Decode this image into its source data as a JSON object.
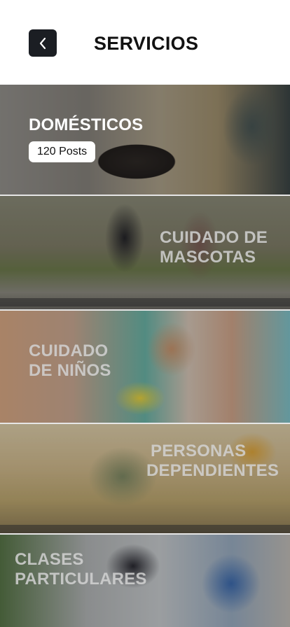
{
  "header": {
    "title": "SERVICIOS",
    "back_icon": "chevron-left-icon"
  },
  "categories": [
    {
      "line1": "DOMÉSTICOS",
      "line2": "",
      "badge": "120 Posts"
    },
    {
      "line1": "CUIDADO DE",
      "line2": "MASCOTAS"
    },
    {
      "line1": "CUIDADO",
      "line2": "DE NIÑOS"
    },
    {
      "line1": "PERSONAS",
      "line2": "DEPENDIENTES"
    },
    {
      "line1": "CLASES",
      "line2": "PARTICULARES"
    }
  ]
}
